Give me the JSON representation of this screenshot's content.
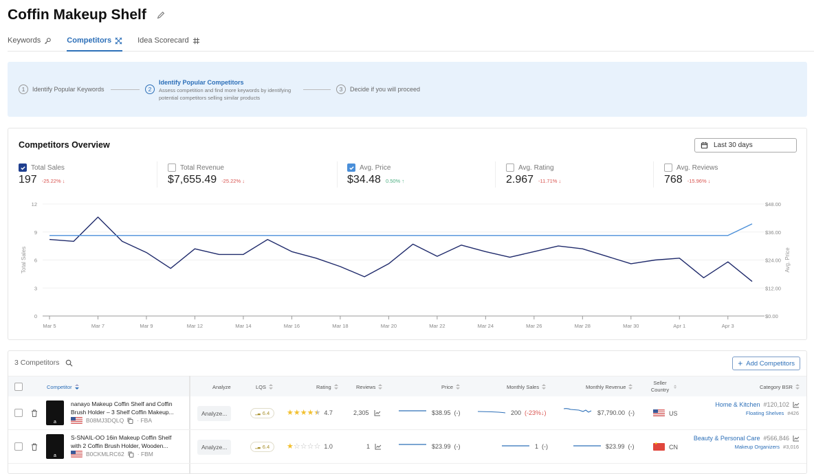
{
  "page": {
    "title": "Coffin Makeup Shelf",
    "tabs": [
      {
        "label": "Keywords",
        "icon": "key-icon"
      },
      {
        "label": "Competitors",
        "icon": "swords-icon",
        "active": true
      },
      {
        "label": "Idea Scorecard",
        "icon": "grid-icon"
      }
    ]
  },
  "stepper": {
    "steps": [
      {
        "num": "1",
        "title": "Identify Popular Keywords"
      },
      {
        "num": "2",
        "title": "Identify Popular Competitors",
        "desc": "Assess competition and find more keywords by identifying potential competitors selling similar products",
        "active": true
      },
      {
        "num": "3",
        "title": "Decide if you will proceed"
      }
    ]
  },
  "overview": {
    "title": "Competitors Overview",
    "date_range": "Last 30 days",
    "metrics": [
      {
        "label": "Total Sales",
        "value": "197",
        "delta": "-25.22%",
        "direction": "down",
        "checked": true
      },
      {
        "label": "Total Revenue",
        "value": "$7,655.49",
        "delta": "-25.22%",
        "direction": "down",
        "checked": false
      },
      {
        "label": "Avg. Price",
        "value": "$34.48",
        "delta": "0.50%",
        "direction": "up",
        "checked": true
      },
      {
        "label": "Avg. Rating",
        "value": "2.967",
        "delta": "-11.71%",
        "direction": "down",
        "checked": false
      },
      {
        "label": "Avg. Reviews",
        "value": "768",
        "delta": "-15.96%",
        "direction": "down",
        "checked": false
      }
    ]
  },
  "chart_data": {
    "type": "line",
    "title": "",
    "xlabel": "",
    "ylabel": "Total Sales",
    "y2label": "Avg. Price",
    "ylim": [
      0,
      12
    ],
    "y2lim": [
      0,
      48
    ],
    "yticks": [
      "0",
      "3",
      "6",
      "9",
      "12"
    ],
    "y2ticks": [
      "$0.00",
      "$12.00",
      "$24.00",
      "$36.00",
      "$48.00"
    ],
    "xtick_labels": [
      "Mar 5",
      "Mar 7",
      "Mar 9",
      "Mar 12",
      "Mar 14",
      "Mar 16",
      "Mar 18",
      "Mar 20",
      "Mar 22",
      "Mar 24",
      "Mar 26",
      "Mar 28",
      "Mar 30",
      "Apr 1",
      "Apr 3"
    ],
    "grid": true,
    "series": [
      {
        "name": "Total Sales",
        "axis": "left",
        "color": "#1f2a6b",
        "values": [
          8.2,
          8.0,
          10.6,
          8.0,
          6.8,
          5.1,
          7.2,
          6.6,
          6.6,
          8.2,
          6.9,
          6.2,
          5.3,
          4.2,
          5.6,
          7.7,
          6.4,
          7.6,
          6.9,
          6.3,
          6.9,
          7.5,
          7.2,
          6.4,
          5.6,
          6.0,
          6.2,
          4.1,
          5.8,
          3.7
        ]
      },
      {
        "name": "Avg. Price",
        "axis": "right",
        "color": "#4a8fd9",
        "values": [
          34.5,
          34.5,
          34.5,
          34.5,
          34.5,
          34.5,
          34.5,
          34.5,
          34.5,
          34.5,
          34.5,
          34.5,
          34.5,
          34.5,
          34.5,
          34.5,
          34.5,
          34.5,
          34.5,
          34.5,
          34.5,
          34.5,
          34.5,
          34.5,
          34.5,
          34.5,
          34.5,
          34.5,
          34.5,
          39.5
        ]
      }
    ]
  },
  "table": {
    "count_label": "3 Competitors",
    "add_button": "Add Competitors",
    "columns": [
      "Competitor",
      "Analyze",
      "LQS",
      "Rating",
      "Reviews",
      "Price",
      "Monthly Sales",
      "Monthly Revenue",
      "Seller Country",
      "Category BSR"
    ],
    "rows": [
      {
        "title_line1": "nanayo Makeup Coffin Shelf and Coffin",
        "title_line2": "Brush Holder – 3 Shelf Coffin Makeup...",
        "asin": "B08MJ3DQLQ",
        "fulfillment": "· FBA",
        "analyze": "Analyze...",
        "lqs": "6.4",
        "rating": "4.7",
        "stars": 4.5,
        "reviews": "2,305",
        "price": "$38.95",
        "price_change": "(-)",
        "monthly_sales": "200",
        "monthly_sales_change": "(-23%↓)",
        "monthly_revenue": "$7,790.00",
        "monthly_revenue_change": "(-)",
        "country": "US",
        "category": "Home & Kitchen",
        "category_rank": "#120,102",
        "subcategory": "Floating Shelves",
        "subcategory_rank": "#426"
      },
      {
        "title_line1": "S-SNAIL-OO 16in Makeup Coffin Shelf",
        "title_line2": "with 2 Coffin Brush Holder, Wooden...",
        "asin": "B0CKMLRC62",
        "fulfillment": "· FBM",
        "analyze": "Analyze...",
        "lqs": "6.4",
        "rating": "1.0",
        "stars": 1,
        "reviews": "1",
        "price": "$23.99",
        "price_change": "(-)",
        "monthly_sales": "1",
        "monthly_sales_change": "(-)",
        "monthly_revenue": "$23.99",
        "monthly_revenue_change": "(-)",
        "country": "CN",
        "category": "Beauty & Personal Care",
        "category_rank": "#566,846",
        "subcategory": "Makeup Organizers",
        "subcategory_rank": "#3,016"
      }
    ]
  }
}
